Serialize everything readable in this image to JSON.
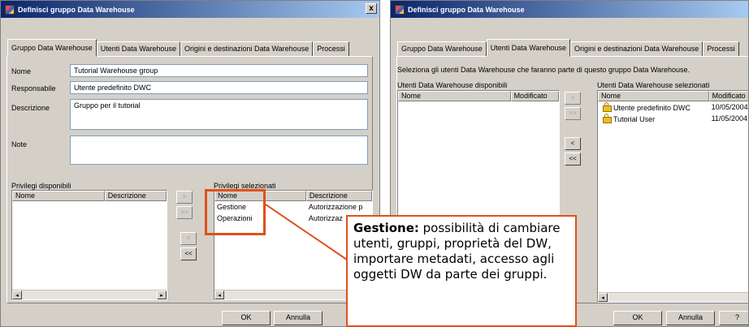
{
  "window_left": {
    "title": "Definisci gruppo Data Warehouse",
    "close_glyph": "x",
    "tabs": [
      {
        "label": "Gruppo Data Warehouse",
        "active": true
      },
      {
        "label": "Utenti Data Warehouse",
        "active": false
      },
      {
        "label": "Origini e destinazioni Data Warehouse",
        "active": false
      },
      {
        "label": "Processi",
        "active": false
      }
    ],
    "form": {
      "name_label": "Nome",
      "name_value": "Tutorial Warehouse group",
      "owner_label": "Responsabile",
      "owner_value": "Utente predefinito DWC",
      "description_label": "Descrizione",
      "description_value": "Gruppo per il tutorial",
      "notes_label": "Note",
      "notes_value": ""
    },
    "available": {
      "title": "Privilegi disponibili",
      "columns": [
        "Nome",
        "Descrizione"
      ],
      "rows": []
    },
    "selected": {
      "title": "Privilegi selezionati",
      "columns": [
        "Nome",
        "Descrizione"
      ],
      "rows": [
        {
          "name": "Gestione",
          "description": "Autorizzazione p"
        },
        {
          "name": "Operazioni",
          "description": "Autorizzaz"
        }
      ]
    },
    "move_buttons": [
      ">",
      ">>",
      "<",
      "<<"
    ],
    "buttons": {
      "ok": "OK",
      "cancel": "Annulla"
    }
  },
  "window_right": {
    "title": "Definisci gruppo Data Warehouse",
    "tabs": [
      {
        "label": "Gruppo Data Warehouse",
        "active": false
      },
      {
        "label": "Utenti Data Warehouse",
        "active": true
      },
      {
        "label": "Origini e destinazioni Data Warehouse",
        "active": false
      },
      {
        "label": "Processi",
        "active": false
      }
    ],
    "instruction": "Seleziona gli utenti Data Warehouse che faranno parte di questo gruppo Data Warehouse.",
    "available": {
      "title": "Utenti Data Warehouse disponibili",
      "columns": [
        "Nome",
        "Modificato"
      ],
      "rows": []
    },
    "selected": {
      "title": "Utenti Data Warehouse selezionati",
      "columns": [
        "Nome",
        "Modificato"
      ],
      "rows": [
        {
          "name": "Utente predefinito DWC",
          "modified": "10/05/2004"
        },
        {
          "name": "Tutorial User",
          "modified": "11/05/2004"
        }
      ]
    },
    "move_buttons": [
      ">",
      ">>",
      "<",
      "<<"
    ],
    "buttons": {
      "ok": "OK",
      "cancel": "Annulla",
      "help": "?"
    }
  },
  "callout": {
    "term": "Gestione:",
    "text": " possibilità di cambiare utenti, gruppi, proprietà del DW, importare metadati, accesso agli oggetti DW da parte dei gruppi."
  },
  "colors": {
    "accent": "#e0501e",
    "titlebar_start": "#0a246a",
    "titlebar_end": "#a6caf0",
    "window_bg": "#d4d0c8"
  },
  "icons": {
    "user_item": "lock-icon",
    "window": "app-icon"
  }
}
